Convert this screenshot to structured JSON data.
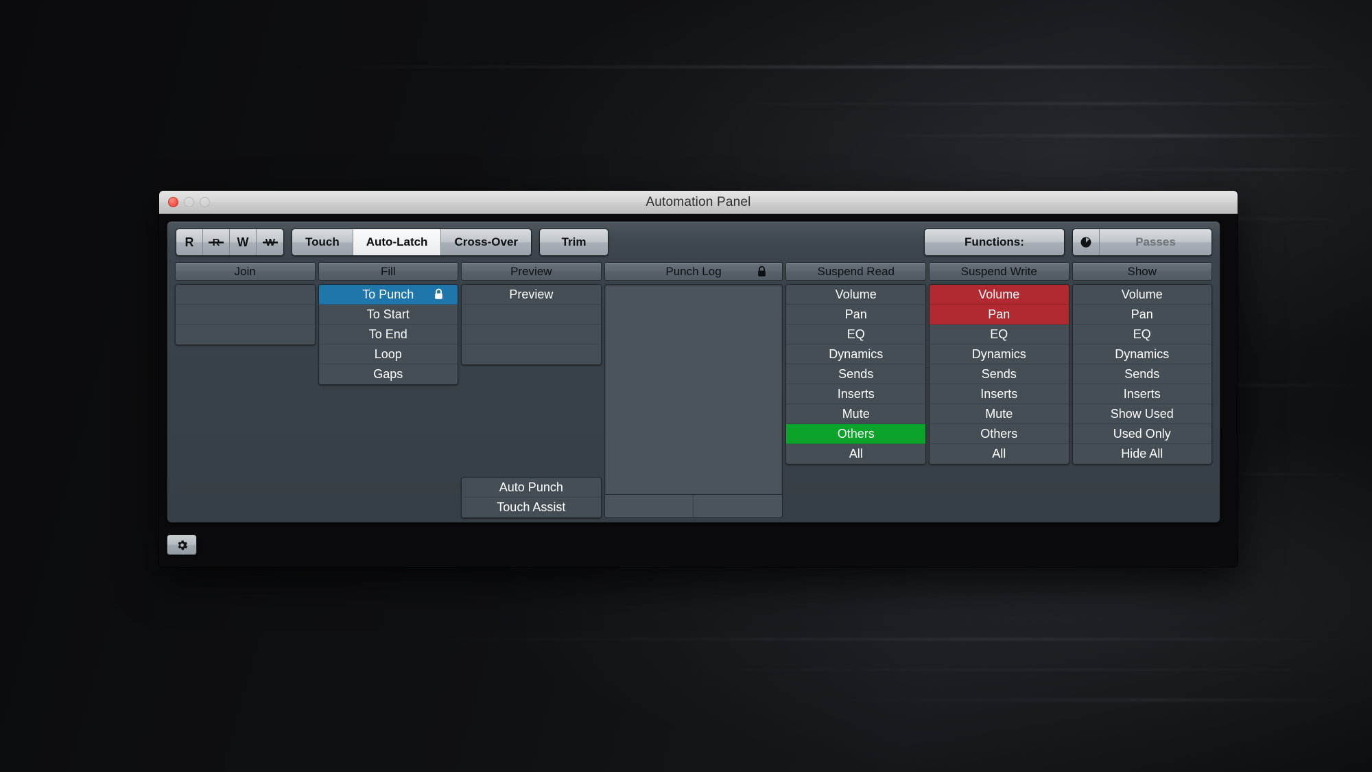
{
  "window": {
    "title": "Automation Panel",
    "traffic_lights": [
      "close",
      "minimize",
      "maximize"
    ]
  },
  "toolbar": {
    "rw_buttons": [
      {
        "label": "R",
        "icon": "read-icon",
        "active": false
      },
      {
        "label": "R",
        "icon": "read-suspended-icon",
        "active": false
      },
      {
        "label": "W",
        "icon": "write-icon",
        "active": false
      },
      {
        "label": "W",
        "icon": "write-suspended-icon",
        "active": false
      }
    ],
    "modes": [
      {
        "label": "Touch",
        "active": false
      },
      {
        "label": "Auto-Latch",
        "active": true
      },
      {
        "label": "Cross-Over",
        "active": false
      }
    ],
    "trim_label": "Trim",
    "functions_label": "Functions:",
    "passes_label": "Passes",
    "passes_icon": "power-knob-icon"
  },
  "columns": [
    {
      "id": "join",
      "header": "Join",
      "header_icon": null,
      "rows": [
        {
          "label": "",
          "state": "empty"
        },
        {
          "label": "",
          "state": "empty"
        },
        {
          "label": "",
          "state": "empty"
        }
      ],
      "bottom_rows": []
    },
    {
      "id": "fill",
      "header": "Fill",
      "header_icon": null,
      "rows": [
        {
          "label": "To Punch",
          "state": "selected-blue",
          "icon": "lock-icon"
        },
        {
          "label": "To Start",
          "state": "normal"
        },
        {
          "label": "To End",
          "state": "normal"
        },
        {
          "label": "Loop",
          "state": "normal"
        },
        {
          "label": "Gaps",
          "state": "normal"
        }
      ],
      "bottom_rows": []
    },
    {
      "id": "preview",
      "header": "Preview",
      "header_icon": null,
      "rows": [
        {
          "label": "Preview",
          "state": "normal"
        },
        {
          "label": "",
          "state": "empty"
        },
        {
          "label": "",
          "state": "empty"
        },
        {
          "label": "",
          "state": "empty"
        }
      ],
      "bottom_rows": [
        {
          "label": "Auto Punch",
          "state": "normal"
        },
        {
          "label": "Touch Assist",
          "state": "normal"
        }
      ]
    },
    {
      "id": "punch-log",
      "header": "Punch Log",
      "header_icon": "lock-icon",
      "rows": [],
      "footer_cells": [
        "",
        ""
      ]
    },
    {
      "id": "suspend-read",
      "header": "Suspend Read",
      "header_icon": null,
      "rows": [
        {
          "label": "Volume",
          "state": "normal"
        },
        {
          "label": "Pan",
          "state": "normal"
        },
        {
          "label": "EQ",
          "state": "normal"
        },
        {
          "label": "Dynamics",
          "state": "normal"
        },
        {
          "label": "Sends",
          "state": "normal"
        },
        {
          "label": "Inserts",
          "state": "normal"
        },
        {
          "label": "Mute",
          "state": "normal"
        },
        {
          "label": "Others",
          "state": "selected-green"
        },
        {
          "label": "All",
          "state": "normal"
        }
      ],
      "bottom_rows": []
    },
    {
      "id": "suspend-write",
      "header": "Suspend Write",
      "header_icon": null,
      "rows": [
        {
          "label": "Volume",
          "state": "selected-red"
        },
        {
          "label": "Pan",
          "state": "selected-red"
        },
        {
          "label": "EQ",
          "state": "normal"
        },
        {
          "label": "Dynamics",
          "state": "normal"
        },
        {
          "label": "Sends",
          "state": "normal"
        },
        {
          "label": "Inserts",
          "state": "normal"
        },
        {
          "label": "Mute",
          "state": "normal"
        },
        {
          "label": "Others",
          "state": "normal"
        },
        {
          "label": "All",
          "state": "normal"
        }
      ],
      "bottom_rows": []
    },
    {
      "id": "show",
      "header": "Show",
      "header_icon": null,
      "rows": [
        {
          "label": "Volume",
          "state": "normal"
        },
        {
          "label": "Pan",
          "state": "normal"
        },
        {
          "label": "EQ",
          "state": "normal"
        },
        {
          "label": "Dynamics",
          "state": "normal"
        },
        {
          "label": "Sends",
          "state": "normal"
        },
        {
          "label": "Inserts",
          "state": "normal"
        },
        {
          "label": "Show Used",
          "state": "normal"
        },
        {
          "label": "Used Only",
          "state": "normal"
        },
        {
          "label": "Hide All",
          "state": "normal"
        }
      ],
      "bottom_rows": []
    }
  ],
  "footer": {
    "gear_icon": "gear-icon"
  },
  "colors": {
    "selected_blue": "#1f76aa",
    "selected_green": "#0ba32a",
    "selected_red": "#b22a31",
    "panel_bg": "#3a424a",
    "list_bg": "#464e55",
    "header_bg": "#5d666f",
    "titlebar_bg": "#d6d6d6"
  }
}
